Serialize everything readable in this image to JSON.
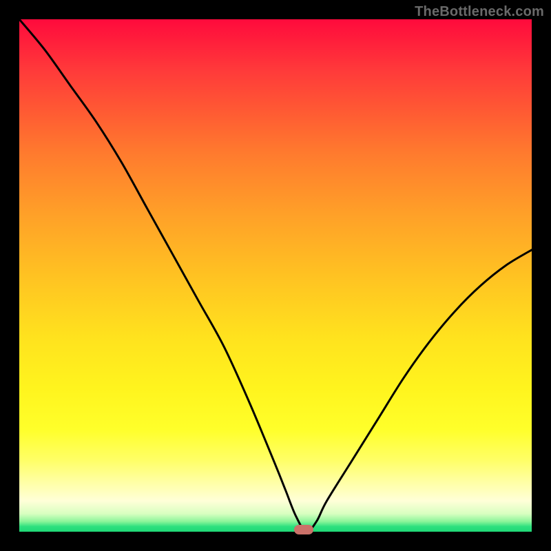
{
  "watermark": "TheBottleneck.com",
  "colors": {
    "frame": "#000000",
    "curve": "#000000",
    "marker": "#cb7169",
    "gradient_top": "#ff0a3c",
    "gradient_mid": "#ffe21e",
    "gradient_bottom": "#1fd876"
  },
  "chart_data": {
    "type": "line",
    "title": "",
    "xlabel": "",
    "ylabel": "",
    "xlim": [
      0,
      100
    ],
    "ylim": [
      0,
      100
    ],
    "grid": false,
    "series": [
      {
        "name": "bottleneck-curve",
        "x": [
          0,
          5,
          10,
          15,
          20,
          25,
          30,
          35,
          40,
          45,
          50,
          52,
          54,
          56,
          58,
          60,
          65,
          70,
          75,
          80,
          85,
          90,
          95,
          100
        ],
        "values": [
          100,
          94,
          87,
          80,
          72,
          63,
          54,
          45,
          36,
          25,
          13,
          8,
          3,
          0,
          2,
          6,
          14,
          22,
          30,
          37,
          43,
          48,
          52,
          55
        ]
      }
    ],
    "marker": {
      "x": 55.5,
      "y": 0,
      "shape": "pill"
    }
  }
}
